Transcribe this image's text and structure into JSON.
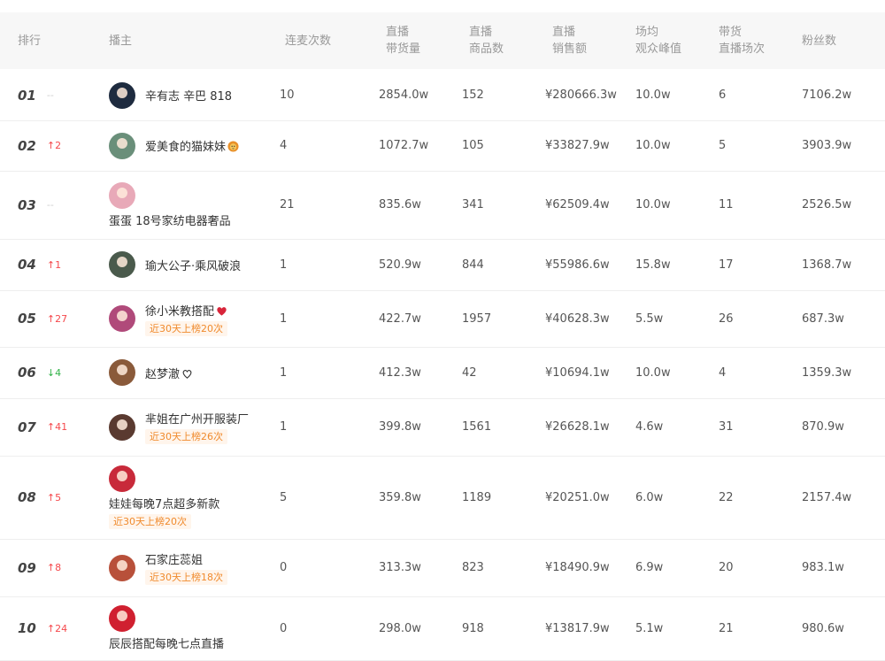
{
  "header": {
    "rank": "排行",
    "anchor": "播主",
    "lianmai": "连麦次数",
    "goods_volume": [
      "直播",
      "带货量"
    ],
    "product_count": [
      "直播",
      "商品数"
    ],
    "sales": [
      "直播",
      "销售额"
    ],
    "peak_viewers": [
      "场均",
      "观众峰值"
    ],
    "sessions": [
      "带货",
      "直播场次"
    ],
    "fans": "粉丝数"
  },
  "rows": [
    {
      "rank": "01",
      "change": "--",
      "dir": "flat",
      "name": "辛有志 辛巴 818",
      "emoji": "",
      "tag": "",
      "layout": "inline",
      "avatar_color": "#1e2b3f",
      "lianmai": "10",
      "volume": "2854.0w",
      "products": "152",
      "sales": "¥280666.3w",
      "peak": "10.0w",
      "sessions": "6",
      "fans": "7106.2w"
    },
    {
      "rank": "02",
      "change": "↑2",
      "dir": "up",
      "name": "爱美食的猫妹妹",
      "emoji": "lion-emoji",
      "tag": "",
      "layout": "inline",
      "avatar_color": "#6a8f7a",
      "lianmai": "4",
      "volume": "1072.7w",
      "products": "105",
      "sales": "¥33827.9w",
      "peak": "10.0w",
      "sessions": "5",
      "fans": "3903.9w"
    },
    {
      "rank": "03",
      "change": "--",
      "dir": "flat",
      "name": "蛋蛋 18号家纺电器奢品",
      "emoji": "",
      "tag": "",
      "layout": "stack",
      "avatar_color": "#e8a9b8",
      "lianmai": "21",
      "volume": "835.6w",
      "products": "341",
      "sales": "¥62509.4w",
      "peak": "10.0w",
      "sessions": "11",
      "fans": "2526.5w"
    },
    {
      "rank": "04",
      "change": "↑1",
      "dir": "up",
      "name": "瑜大公子·乘风破浪",
      "emoji": "",
      "tag": "",
      "layout": "inline",
      "avatar_color": "#4a5a4c",
      "lianmai": "1",
      "volume": "520.9w",
      "products": "844",
      "sales": "¥55986.6w",
      "peak": "15.8w",
      "sessions": "17",
      "fans": "1368.7w"
    },
    {
      "rank": "05",
      "change": "↑27",
      "dir": "up",
      "name": "徐小米教搭配",
      "emoji": "heart-emoji",
      "tag": "近30天上榜20次",
      "layout": "inline",
      "avatar_color": "#b04a7a",
      "lianmai": "1",
      "volume": "422.7w",
      "products": "1957",
      "sales": "¥40628.3w",
      "peak": "5.5w",
      "sessions": "26",
      "fans": "687.3w"
    },
    {
      "rank": "06",
      "change": "↓4",
      "dir": "down",
      "name": "赵梦澈",
      "emoji": "heart-outline-emoji",
      "tag": "",
      "layout": "inline",
      "avatar_color": "#8a5a3a",
      "lianmai": "1",
      "volume": "412.3w",
      "products": "42",
      "sales": "¥10694.1w",
      "peak": "10.0w",
      "sessions": "4",
      "fans": "1359.3w"
    },
    {
      "rank": "07",
      "change": "↑41",
      "dir": "up",
      "name": "芈姐在广州开服装厂",
      "emoji": "",
      "tag": "近30天上榜26次",
      "layout": "inline",
      "avatar_color": "#5a3a30",
      "lianmai": "1",
      "volume": "399.8w",
      "products": "1561",
      "sales": "¥26628.1w",
      "peak": "4.6w",
      "sessions": "31",
      "fans": "870.9w"
    },
    {
      "rank": "08",
      "change": "↑5",
      "dir": "up",
      "name": "娃娃每晚7点超多新款",
      "emoji": "",
      "tag": "近30天上榜20次",
      "layout": "stack",
      "avatar_color": "#c82a3a",
      "lianmai": "5",
      "volume": "359.8w",
      "products": "1189",
      "sales": "¥20251.0w",
      "peak": "6.0w",
      "sessions": "22",
      "fans": "2157.4w"
    },
    {
      "rank": "09",
      "change": "↑8",
      "dir": "up",
      "name": "石家庄蕊姐",
      "emoji": "",
      "tag": "近30天上榜18次",
      "layout": "inline",
      "avatar_color": "#b8503a",
      "lianmai": "0",
      "volume": "313.3w",
      "products": "823",
      "sales": "¥18490.9w",
      "peak": "6.9w",
      "sessions": "20",
      "fans": "983.1w"
    },
    {
      "rank": "10",
      "change": "↑24",
      "dir": "up",
      "name": "辰辰搭配每晚七点直播",
      "emoji": "",
      "tag": "",
      "layout": "stack",
      "avatar_color": "#d02030",
      "lianmai": "0",
      "volume": "298.0w",
      "products": "918",
      "sales": "¥13817.9w",
      "peak": "5.1w",
      "sessions": "21",
      "fans": "980.6w"
    }
  ]
}
